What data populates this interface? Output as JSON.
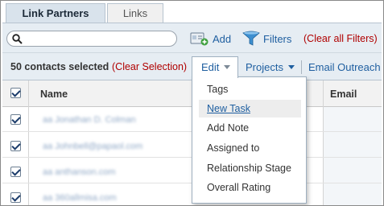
{
  "tabs": [
    {
      "label": "Link Partners",
      "active": true
    },
    {
      "label": "Links",
      "active": false
    }
  ],
  "toolbar": {
    "search_placeholder": "",
    "add_label": "Add",
    "filters_label": "Filters",
    "clear_filters": "(Clear all Filters)"
  },
  "selection": {
    "count_text": "50 contacts selected",
    "clear_label": "(Clear Selection)",
    "edit_label": "Edit",
    "projects_label": "Projects",
    "outreach_label": "Email Outreach"
  },
  "table": {
    "headers": {
      "name": "Name",
      "email": "Email"
    },
    "rows": [
      {
        "checked": true,
        "name": "aa Jonathan D. Colman"
      },
      {
        "checked": true,
        "name": "aa Johnbell@papaol.com"
      },
      {
        "checked": true,
        "name": "aa anthanson.com"
      },
      {
        "checked": true,
        "name": "aa 360allmisa.com"
      }
    ]
  },
  "edit_menu": {
    "items": [
      "Tags",
      "New Task",
      "Add Note",
      "Assigned to",
      "Relationship Stage",
      "Overall Rating"
    ],
    "hovered": "New Task"
  },
  "colors": {
    "link": "#1f5fa0",
    "clear_red": "#b00000",
    "toolbar_bg": "#e6edf3",
    "tab_active_bg": "#d9e3ec"
  },
  "icons": {
    "search": "search-icon",
    "add": "add-contact-icon",
    "filter": "filter-funnel-icon",
    "caret": "chevron-down-icon"
  }
}
